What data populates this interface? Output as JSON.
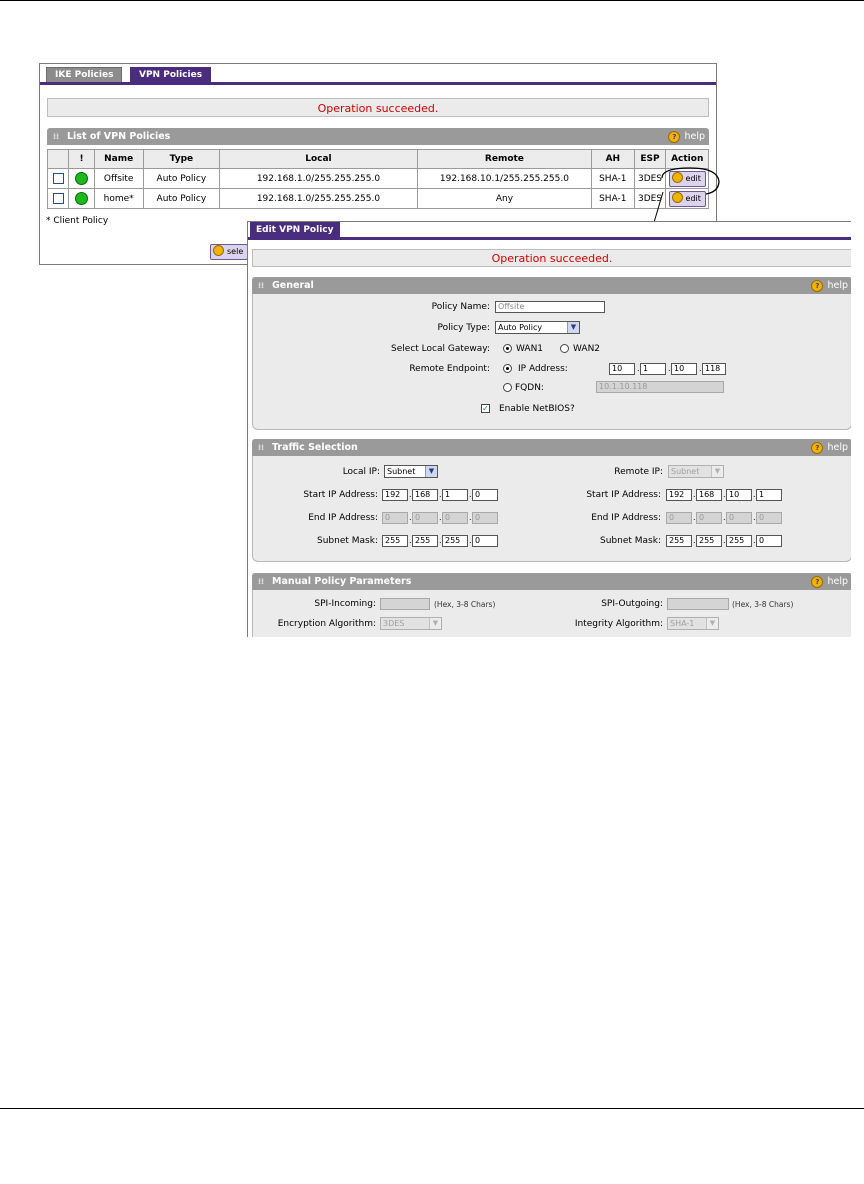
{
  "list_window": {
    "tabs": [
      "IKE Policies",
      "VPN Policies"
    ],
    "message": "Operation succeeded.",
    "section_title": "List of VPN Policies",
    "help_label": "help",
    "columns": [
      "!",
      "Name",
      "Type",
      "Local",
      "Remote",
      "AH",
      "ESP",
      "Action"
    ],
    "rows": [
      {
        "name": "Offsite",
        "type": "Auto Policy",
        "local": "192.168.1.0/255.255.255.0",
        "remote": "192.168.10.1/255.255.255.0",
        "ah": "SHA-1",
        "esp": "3DES",
        "action": "edit"
      },
      {
        "name": "home*",
        "type": "Auto Policy",
        "local": "192.168.1.0/255.255.255.0",
        "remote": "Any",
        "ah": "SHA-1",
        "esp": "3DES",
        "action": "edit"
      }
    ],
    "footnote": "* Client Policy",
    "select_button_partial": "sele"
  },
  "edit_window": {
    "tab": "Edit VPN Policy",
    "message": "Operation succeeded.",
    "help_label": "help",
    "general": {
      "title": "General",
      "policy_name_label": "Policy Name:",
      "policy_name_value": "Offsite",
      "policy_type_label": "Policy Type:",
      "policy_type_value": "Auto Policy",
      "local_gateway_label": "Select Local Gateway:",
      "wan1_label": "WAN1",
      "wan2_label": "WAN2",
      "remote_endpoint_label": "Remote Endpoint:",
      "ip_address_label": "IP Address:",
      "ip_octets": [
        "10",
        "1",
        "10",
        "118"
      ],
      "fqdn_label": "FQDN:",
      "fqdn_value": "10.1.10.118",
      "netbios_label": "Enable NetBIOS?"
    },
    "traffic": {
      "title": "Traffic Selection",
      "local_ip_label": "Local IP:",
      "local_ip_value": "Subnet",
      "remote_ip_label": "Remote IP:",
      "remote_ip_value": "Subnet",
      "start_ip_label": "Start IP Address:",
      "end_ip_label": "End IP Address:",
      "subnet_mask_label": "Subnet Mask:",
      "local_start": [
        "192",
        "168",
        "1",
        "0"
      ],
      "local_end": [
        "0",
        "0",
        "0",
        "0"
      ],
      "local_mask": [
        "255",
        "255",
        "255",
        "0"
      ],
      "remote_start": [
        "192",
        "168",
        "10",
        "1"
      ],
      "remote_end": [
        "0",
        "0",
        "0",
        "0"
      ],
      "remote_mask": [
        "255",
        "255",
        "255",
        "0"
      ]
    },
    "manual": {
      "title": "Manual Policy Parameters",
      "spi_in_label": "SPI-Incoming:",
      "spi_out_label": "SPI-Outgoing:",
      "hex_hint": "(Hex, 3-8 Chars)",
      "enc_label": "Encryption Algorithm:",
      "enc_value": "3DES",
      "integ_label": "Integrity Algorithm:",
      "integ_value": "SHA-1"
    }
  }
}
